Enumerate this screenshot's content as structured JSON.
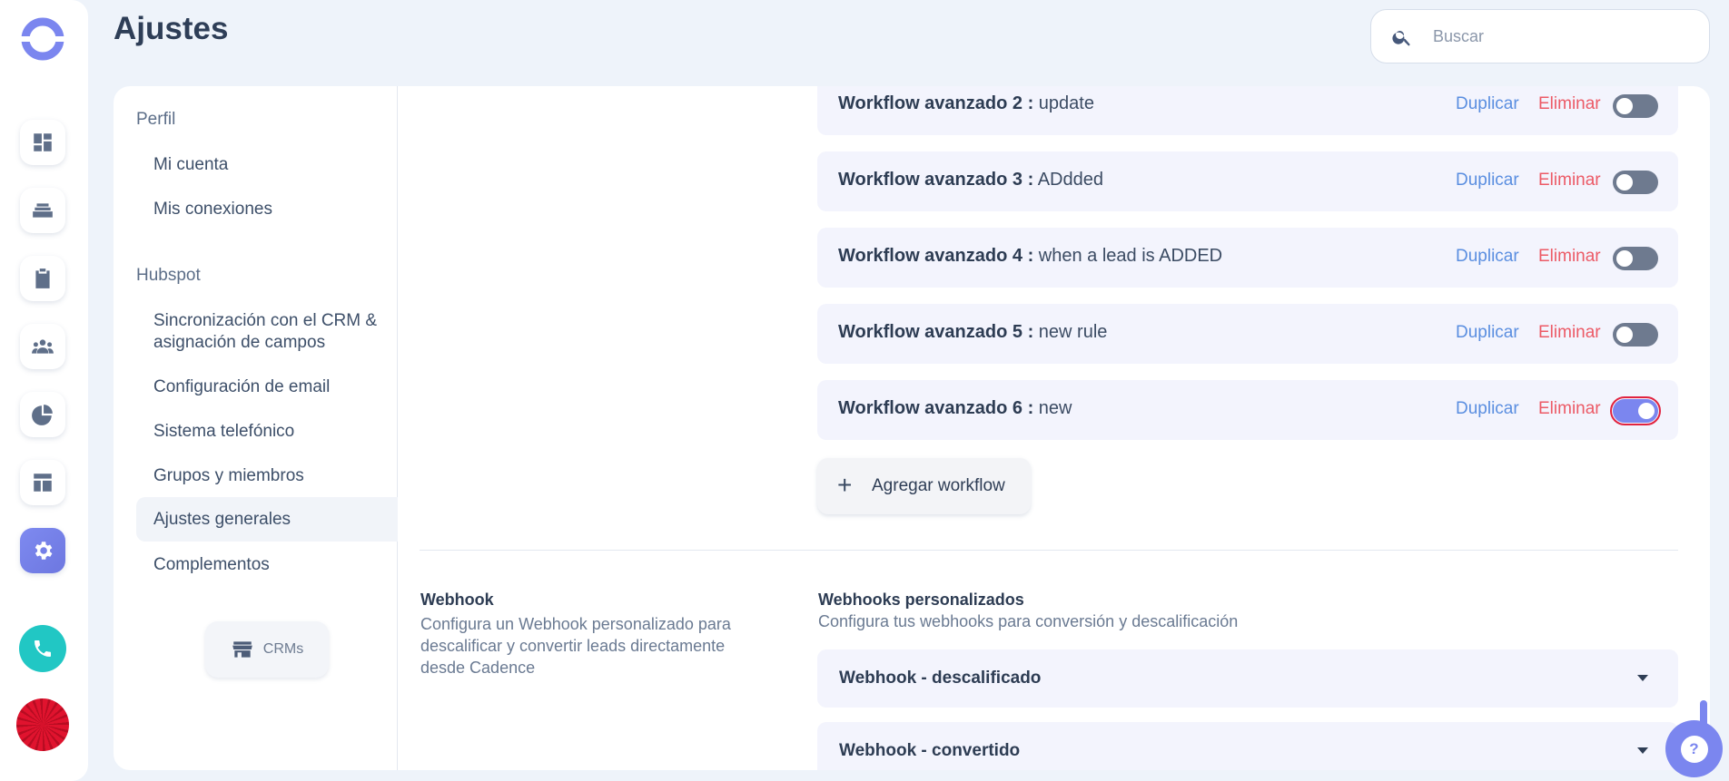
{
  "header": {
    "title": "Ajustes"
  },
  "search": {
    "placeholder": "Buscar"
  },
  "colors": {
    "accent": "#7b86ef",
    "danger": "#ec5a66",
    "link": "#5a8ee0",
    "phone": "#21c7c4"
  },
  "rail": {
    "icons": [
      "dashboard-icon",
      "inbox-icon",
      "clipboard-icon",
      "contacts-icon",
      "reports-icon",
      "templates-icon",
      "settings-icon"
    ],
    "active": "settings-icon"
  },
  "nav": {
    "sections": [
      {
        "label": "Perfil",
        "items": [
          "Mi cuenta",
          "Mis conexiones"
        ]
      },
      {
        "label": "Hubspot",
        "items": [
          "Sincronización con el CRM & asignación de campos",
          "Configuración de email",
          "Sistema telefónico",
          "Grupos y miembros",
          "Ajustes generales",
          "Complementos"
        ]
      }
    ],
    "active_item": "Ajustes generales",
    "crm_button": "CRMs"
  },
  "workflows": {
    "rows": [
      {
        "name": "Workflow avanzado 2 :",
        "value": "update",
        "enabled": false
      },
      {
        "name": "Workflow avanzado 3 :",
        "value": "ADdded",
        "enabled": false
      },
      {
        "name": "Workflow avanzado 4 :",
        "value": "when a lead is ADDED",
        "enabled": false
      },
      {
        "name": "Workflow avanzado 5 :",
        "value": "new rule",
        "enabled": false
      },
      {
        "name": "Workflow avanzado 6 :",
        "value": "new",
        "enabled": true
      }
    ],
    "duplicate_label": "Duplicar",
    "delete_label": "Eliminar",
    "add_label": "Agregar workflow"
  },
  "webhook": {
    "title": "Webhook",
    "description": "Configura un Webhook personalizado para descalificar y convertir leads directamente desde Cadence",
    "custom_title": "Webhooks personalizados",
    "custom_description": "Configura tus webhooks para conversión y descalificación",
    "items": [
      "Webhook - descalificado",
      "Webhook - convertido"
    ]
  },
  "help": {
    "label": "?"
  }
}
